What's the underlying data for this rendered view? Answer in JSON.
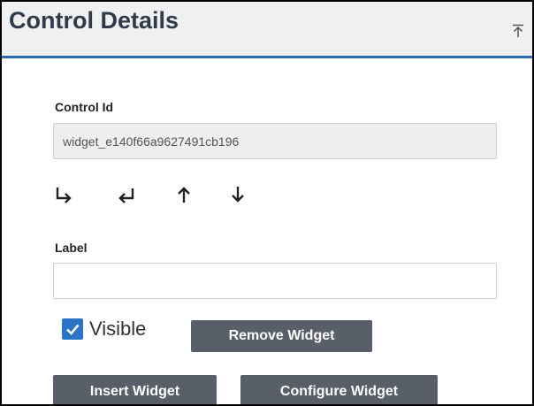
{
  "header": {
    "title": "Control Details",
    "collapse_icon": "collapse-up-icon"
  },
  "control_id": {
    "label": "Control Id",
    "value": "widget_e140f66a9627491cb196"
  },
  "arrows": [
    {
      "icon": "move-right-icon"
    },
    {
      "icon": "move-left-icon"
    },
    {
      "icon": "move-up-icon"
    },
    {
      "icon": "move-down-icon"
    }
  ],
  "label_field": {
    "label": "Label",
    "value": ""
  },
  "visible": {
    "label": "Visible",
    "checked": true
  },
  "buttons": {
    "remove": "Remove Widget",
    "insert": "Insert Widget",
    "configure": "Configure Widget"
  },
  "colors": {
    "header_bg": "#f0f0f0",
    "accent": "#2b6cb0",
    "button_bg": "#595f68",
    "checkbox": "#2b73c4"
  }
}
